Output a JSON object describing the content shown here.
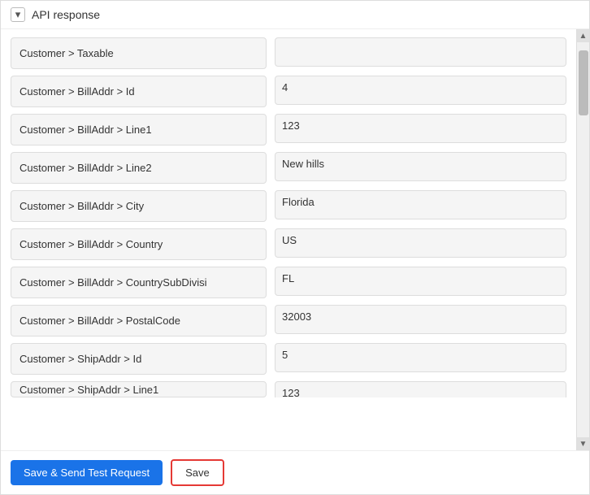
{
  "header": {
    "title": "API response",
    "chevron": "▾"
  },
  "fields": [
    {
      "label": "Customer > Taxable",
      "value": ""
    },
    {
      "label": "Customer > BillAddr > Id",
      "value": "4"
    },
    {
      "label": "Customer > BillAddr > Line1",
      "value": "123"
    },
    {
      "label": "Customer > BillAddr > Line2",
      "value": "New hills"
    },
    {
      "label": "Customer > BillAddr > City",
      "value": "Florida"
    },
    {
      "label": "Customer > BillAddr > Country",
      "value": "US"
    },
    {
      "label": "Customer > BillAddr > CountrySubDivisi",
      "value": "FL"
    },
    {
      "label": "Customer > BillAddr > PostalCode",
      "value": "32003"
    },
    {
      "label": "Customer > ShipAddr > Id",
      "value": "5"
    },
    {
      "label": "Customer > ShipAddr > Line1",
      "value": "123"
    }
  ],
  "footer": {
    "save_send_label": "Save & Send Test Request",
    "save_label": "Save"
  }
}
